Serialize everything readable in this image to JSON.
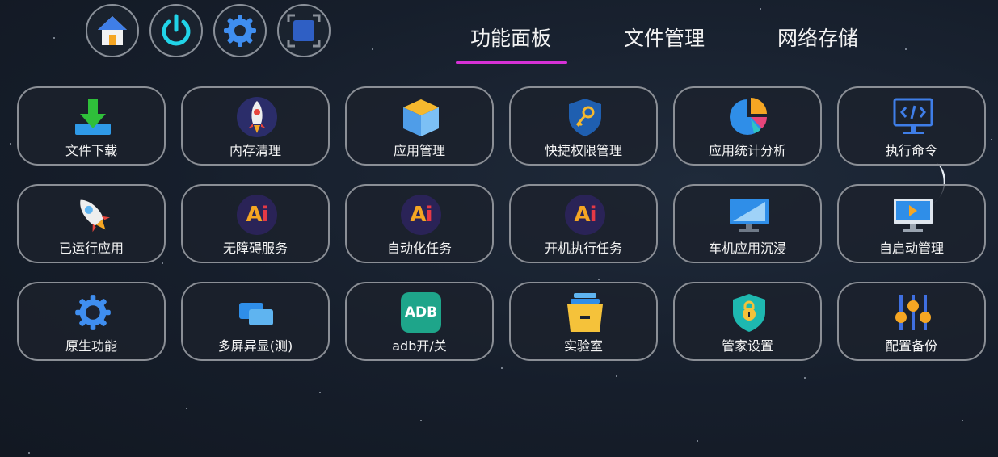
{
  "top_buttons": [
    {
      "icon": "home-icon"
    },
    {
      "icon": "power-icon"
    },
    {
      "icon": "gear-icon"
    },
    {
      "icon": "screen-capture-icon"
    }
  ],
  "tabs": [
    {
      "label": "功能面板",
      "active": true
    },
    {
      "label": "文件管理",
      "active": false
    },
    {
      "label": "网络存储",
      "active": false
    }
  ],
  "accent_color": "#d631d6",
  "grid": {
    "row1": [
      {
        "label": "文件下载",
        "icon": "download-icon"
      },
      {
        "label": "内存清理",
        "icon": "rocket-icon"
      },
      {
        "label": "应用管理",
        "icon": "box-icon"
      },
      {
        "label": "快捷权限管理",
        "icon": "shield-key-icon"
      },
      {
        "label": "应用统计分析",
        "icon": "pie-chart-icon"
      },
      {
        "label": "执行命令",
        "icon": "code-monitor-icon"
      }
    ],
    "row2": [
      {
        "label": "已运行应用",
        "icon": "rocket-launch-icon"
      },
      {
        "label": "无障碍服务",
        "icon": "ai-icon"
      },
      {
        "label": "自动化任务",
        "icon": "ai-icon"
      },
      {
        "label": "开机执行任务",
        "icon": "ai-icon"
      },
      {
        "label": "车机应用沉浸",
        "icon": "monitor-icon"
      },
      {
        "label": "自启动管理",
        "icon": "video-monitor-icon"
      }
    ],
    "row3": [
      {
        "label": "原生功能",
        "icon": "gear-icon"
      },
      {
        "label": "多屏异显(测)",
        "icon": "multi-screen-icon"
      },
      {
        "label": "adb开/关",
        "icon": "adb-icon",
        "icon_text": "ADB"
      },
      {
        "label": "实验室",
        "icon": "archive-icon"
      },
      {
        "label": "管家设置",
        "icon": "shield-lock-icon"
      },
      {
        "label": "配置备份",
        "icon": "sliders-icon"
      }
    ]
  },
  "ai_icon_text": {
    "a": "A",
    "i": "i"
  }
}
